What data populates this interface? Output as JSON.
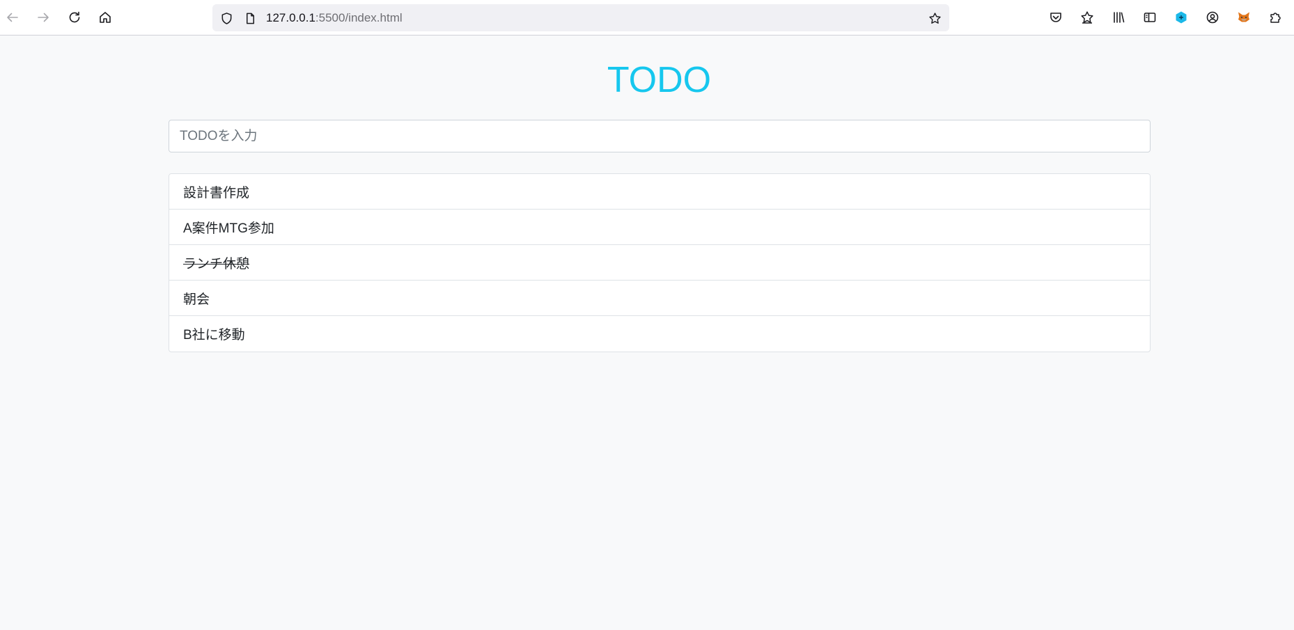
{
  "browser": {
    "url_host": "127.0.0.1",
    "url_path": ":5500/index.html",
    "icons": {
      "back": "arrow-left-icon",
      "forward": "arrow-right-icon",
      "reload": "reload-icon",
      "home": "home-icon",
      "tracking": "shield-icon",
      "page": "page-icon",
      "bookmark": "star-icon",
      "pocket": "pocket-icon",
      "bookmarks_menu": "bookmarks-star-icon",
      "library": "library-icon",
      "sidebar": "sidebar-icon",
      "extension_cube": "cube-extension-icon",
      "account": "account-icon",
      "metamask": "fox-icon",
      "extensions": "puzzle-icon"
    },
    "accent": "#1bb8e8"
  },
  "page": {
    "title": "TODO",
    "title_color": "#16c7ee",
    "input_placeholder": "TODOを入力",
    "input_value": "",
    "todos": [
      {
        "text": "設計書作成",
        "done": false
      },
      {
        "text": "A案件MTG参加",
        "done": false
      },
      {
        "text": "ランチ休憩",
        "done": true
      },
      {
        "text": "朝会",
        "done": false
      },
      {
        "text": "B社に移動",
        "done": false
      }
    ]
  }
}
